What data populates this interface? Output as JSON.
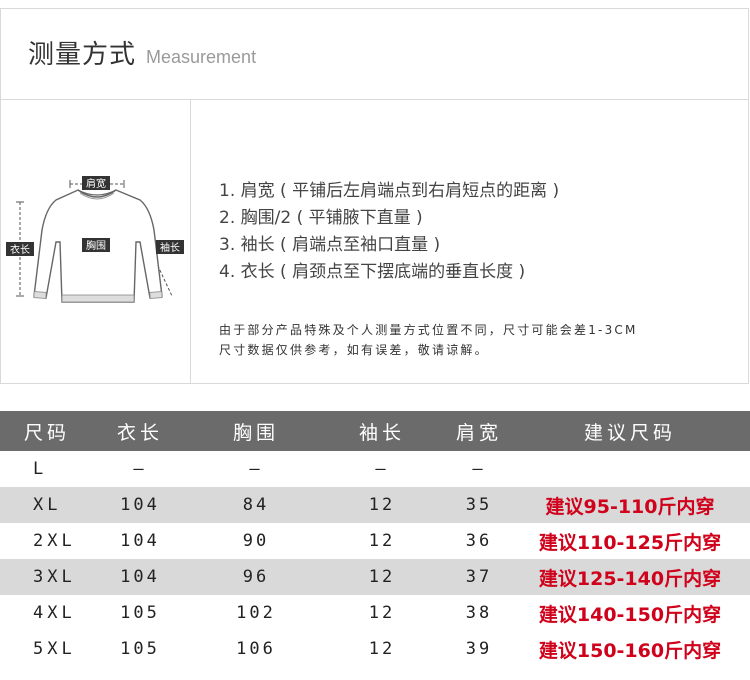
{
  "header": {
    "title_cn": "测量方式",
    "title_en": "Measurement"
  },
  "diagram": {
    "label_shoulder": "肩宽",
    "label_chest": "胸围",
    "label_length": "衣长",
    "label_sleeve": "袖长"
  },
  "instructions": [
    "1. 肩宽 ( 平铺后左肩端点到右肩短点的距离 )",
    "2. 胸围/2 ( 平铺腋下直量 )",
    "3. 袖长 ( 肩端点至袖口直量 )",
    "4. 衣长 ( 肩颈点至下摆底端的垂直长度 )"
  ],
  "note": [
    "由于部分产品特殊及个人测量方式位置不同，尺寸可能会差1-3CM",
    "尺寸数据仅供参考，如有误差，敬请谅解。"
  ],
  "table": {
    "headers": [
      "尺码",
      "衣长",
      "胸围",
      "袖长",
      "肩宽",
      "建议尺码"
    ],
    "rows": [
      [
        "L",
        "–",
        "–",
        "–",
        "–",
        ""
      ],
      [
        "XL",
        "104",
        "84",
        "12",
        "35",
        "建议95-110斤内穿"
      ],
      [
        "2XL",
        "104",
        "90",
        "12",
        "36",
        "建议110-125斤内穿"
      ],
      [
        "3XL",
        "104",
        "96",
        "12",
        "37",
        "建议125-140斤内穿"
      ],
      [
        "4XL",
        "105",
        "102",
        "12",
        "38",
        "建议140-150斤内穿"
      ],
      [
        "5XL",
        "105",
        "106",
        "12",
        "39",
        "建议150-160斤内穿"
      ]
    ]
  }
}
